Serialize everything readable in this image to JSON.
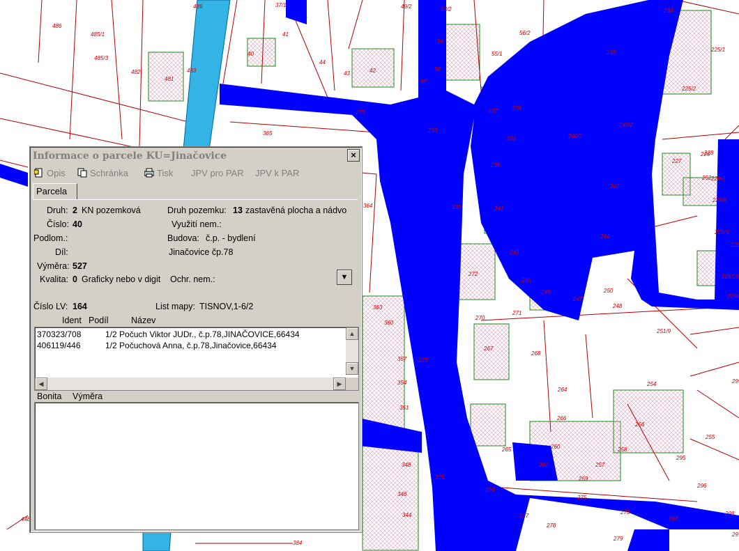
{
  "window": {
    "title": "Informace o parcele  KU=Jinačovice",
    "close_label": "×"
  },
  "toolbar": {
    "opis": "Opis",
    "schranka": "Schránka",
    "tisk": "Tisk",
    "jpv_pro_par": "JPV pro PAR",
    "jpv_k_par": "JPV k PAR"
  },
  "tabs": {
    "parcela": "Parcela"
  },
  "parcel": {
    "druh_label": "Druh:",
    "druh_value": "2",
    "druh_text": "KN pozemková",
    "druh_pozemku_label": "Druh pozemku:",
    "druh_pozemku_value": "13",
    "druh_pozemku_text": "zastavěná plocha a nádvo",
    "cislo_label": "Číslo:",
    "cislo_value": "40",
    "vyuziti_label": "Využití nem.:",
    "podlom_label": "Podlom.:",
    "budova_label": "Budova:",
    "budova_value": "č.p. - bydlení",
    "dil_label": "Díl:",
    "budova_address": "Jinačovice čp.78",
    "vymera_label": "Výměra:",
    "vymera_value": "527",
    "kvalita_label": "Kvalita:",
    "kvalita_value": "0",
    "kvalita_text": "Graficky nebo v digit",
    "ochr_label": "Ochr. nem.:",
    "cislo_lv_label": "Číslo LV:",
    "cislo_lv_value": "164",
    "list_mapy_label": "List mapy:",
    "list_mapy_value": "TISNOV,1-6/2"
  },
  "owners": {
    "headers": {
      "ident": "Ident",
      "podil": "Podíl",
      "nazev": "Název"
    },
    "rows": [
      {
        "ident": "370323/708",
        "text": "1/2 Počuch Viktor JUDr., č.p.78,JINAČOVICE,66434"
      },
      {
        "ident": "406119/446",
        "text": "1/2 Počuchová Anna, č.p.78,Jinačovice,66434"
      }
    ]
  },
  "bonita": {
    "headers": {
      "bonita": "Bonita",
      "vymera": "Výměra"
    }
  },
  "map": {
    "labels": [
      "486",
      "485/1",
      "485/3",
      "482",
      "481",
      "483",
      "489",
      "37/1",
      "40",
      "41",
      "44",
      "43",
      "42",
      "49/2",
      "53/2",
      "54",
      "56",
      "57",
      "55/1",
      "56/2",
      "234",
      "235",
      "225/1",
      "225/2",
      "236",
      "237",
      "238",
      "239",
      "240/1",
      "240/2",
      "226",
      "227",
      "228",
      "229/3",
      "229/8",
      "229/9",
      "229/4",
      "229/10",
      "229/5",
      "241",
      "242",
      "243",
      "244",
      "246",
      "247",
      "248",
      "249",
      "251/9",
      "272",
      "270",
      "271",
      "267",
      "268",
      "254",
      "256",
      "255",
      "257",
      "258",
      "259",
      "260",
      "262",
      "264",
      "265",
      "266",
      "273",
      "274",
      "275",
      "276",
      "277",
      "278",
      "279",
      "294",
      "295",
      "296",
      "297",
      "298",
      "299",
      "344",
      "346",
      "348",
      "351",
      "354",
      "357",
      "360",
      "363",
      "365",
      "373",
      "384",
      "448",
      "325",
      "232",
      "233",
      "364",
      "250",
      "252"
    ],
    "water_color": "#33b3e6",
    "road_color": "#0000ff",
    "parcel_line_color": "#b00000",
    "building_line_color": "#1a8a1a"
  }
}
